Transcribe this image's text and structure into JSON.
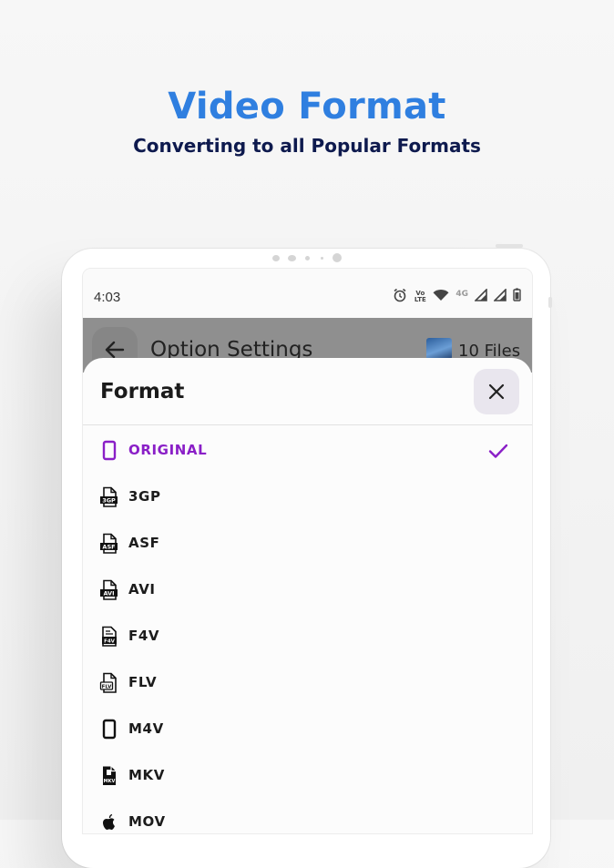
{
  "promo": {
    "headline": "Video Format",
    "subline": "Converting to all Popular Formats"
  },
  "colors": {
    "headline": "#2f7fe0",
    "subline": "#0e1a4e",
    "accent": "#8a1fc7"
  },
  "status_bar": {
    "time": "4:03",
    "icons": [
      "alarm-icon",
      "volte-icon",
      "wifi-icon",
      "4g-icon",
      "signal-icon",
      "signal-icon",
      "battery-icon"
    ],
    "volte_label": "Vo LTE",
    "network_label": "4G"
  },
  "app_bar": {
    "title": "Option Settings",
    "files": "10 Files"
  },
  "sheet": {
    "title": "Format",
    "selected": "ORIGINAL",
    "options": [
      {
        "label": "ORIGINAL",
        "icon": "phone-icon",
        "badge": ""
      },
      {
        "label": "3GP",
        "icon": "file-3gp-icon",
        "badge": "3GP"
      },
      {
        "label": "ASF",
        "icon": "file-asf-icon",
        "badge": "ASF"
      },
      {
        "label": "AVI",
        "icon": "file-avi-icon",
        "badge": "AVI"
      },
      {
        "label": "F4V",
        "icon": "file-f4v-icon",
        "badge": "F4V"
      },
      {
        "label": "FLV",
        "icon": "file-flv-icon",
        "badge": "FLV"
      },
      {
        "label": "M4V",
        "icon": "phone-icon",
        "badge": ""
      },
      {
        "label": "MKV",
        "icon": "file-mkv-icon",
        "badge": "MKV"
      },
      {
        "label": "MOV",
        "icon": "apple-icon",
        "badge": ""
      }
    ]
  }
}
